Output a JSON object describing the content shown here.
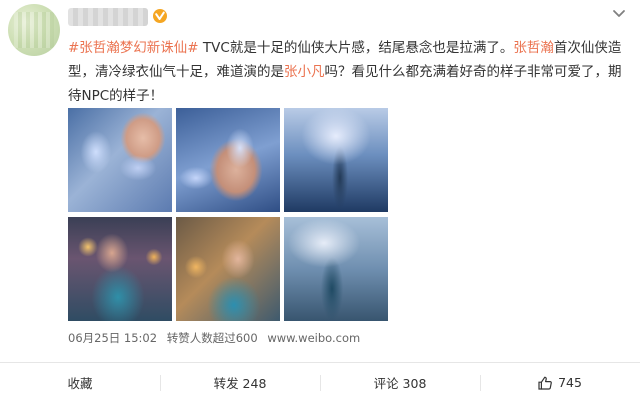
{
  "post": {
    "avatar_icon": "avatar-blurred",
    "verified_icon": "verified-badge-icon",
    "dropdown_icon": "chevron-down-icon",
    "text_segments": [
      {
        "type": "tag",
        "text": "#张哲瀚梦幻新诛仙#"
      },
      {
        "type": "text",
        "text": " TVC就是十足的仙侠大片感，结尾悬念也是拉满了。"
      },
      {
        "type": "link",
        "text": "张哲瀚"
      },
      {
        "type": "text",
        "text": "首次仙侠造型，清冷绿衣仙气十足，难道演的是"
      },
      {
        "type": "link",
        "text": "张小凡"
      },
      {
        "type": "text",
        "text": "吗？看见什么都充满着好奇的样子非常可爱了，期待NPC的样子！"
      }
    ],
    "images": [
      {
        "alt": "image-1"
      },
      {
        "alt": "image-2"
      },
      {
        "alt": "image-3"
      },
      {
        "alt": "image-4"
      },
      {
        "alt": "image-5"
      },
      {
        "alt": "image-6"
      }
    ],
    "meta": {
      "date": "06月25日 15:02",
      "likes_text": "转赞人数超过600",
      "domain_text": "www.weibo.com"
    }
  },
  "actions": {
    "collect": "收藏",
    "repost": "转发 248",
    "comment": "评论 308",
    "like_count": "745",
    "like_icon": "thumbs-up-icon"
  },
  "colors": {
    "link": "#eb7350",
    "text": "#333333",
    "meta": "#666666",
    "divider": "#e6e6e6"
  }
}
